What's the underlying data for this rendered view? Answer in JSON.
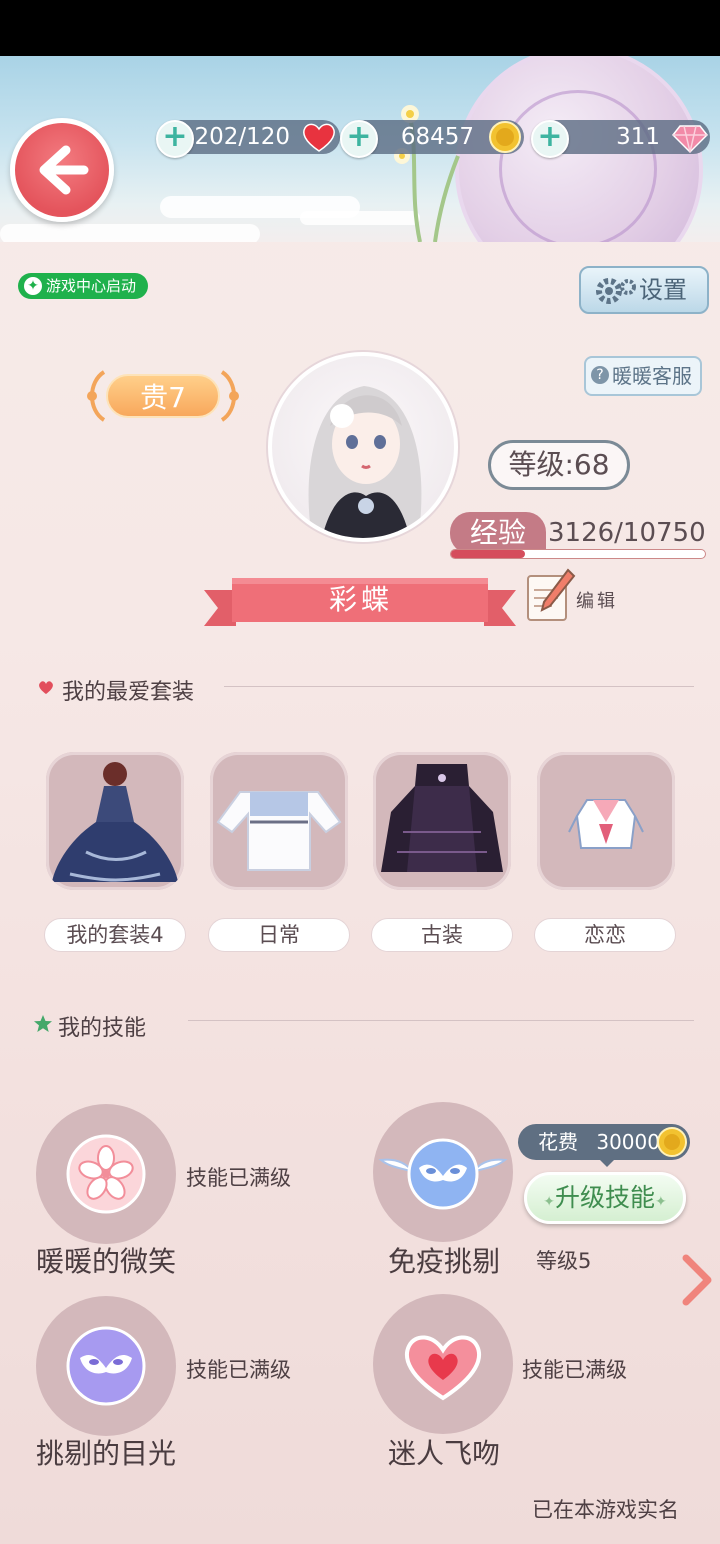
{
  "resources": {
    "stamina": "202/120",
    "coins": "68457",
    "diamonds": "311"
  },
  "sync_badge": "游戏中心启动",
  "settings_label": "设置",
  "support_label": "暖暖客服",
  "vip_label": "贵7",
  "level_label": "等级:68",
  "exp": {
    "label": "经验",
    "value": "3126/10750",
    "progress": 0.29
  },
  "player_name": "彩蝶",
  "edit_label": "编辑",
  "favorites": {
    "title": "我的最爱套装",
    "items": [
      {
        "label": "我的套装4",
        "icon": "navy-gown-icon"
      },
      {
        "label": "日常",
        "icon": "white-blouse-icon"
      },
      {
        "label": "古装",
        "icon": "black-robe-icon"
      },
      {
        "label": "恋恋",
        "icon": "school-uniform-icon"
      }
    ]
  },
  "skills": {
    "title": "我的技能",
    "items": [
      {
        "name": "暖暖的微笑",
        "status": "技能已满级",
        "icon": "cherry-blossom-icon"
      },
      {
        "name": "免疫挑剔",
        "icon": "winged-mask-icon"
      },
      {
        "name": "挑剔的目光",
        "status": "技能已满级",
        "icon": "purple-mask-icon"
      },
      {
        "name": "迷人飞吻",
        "status": "技能已满级",
        "icon": "heart-icon"
      }
    ],
    "upgrade": {
      "cost_label": "花费",
      "cost_value": "30000",
      "button_label": "升级技能",
      "level_label": "等级5"
    }
  },
  "footer_note": "已在本游戏实名",
  "colors": {
    "accent": "#e4545c",
    "ribbon": "#ef6f78",
    "tile": "#d3b8bb",
    "upgrade_text": "#3f8d4f"
  }
}
